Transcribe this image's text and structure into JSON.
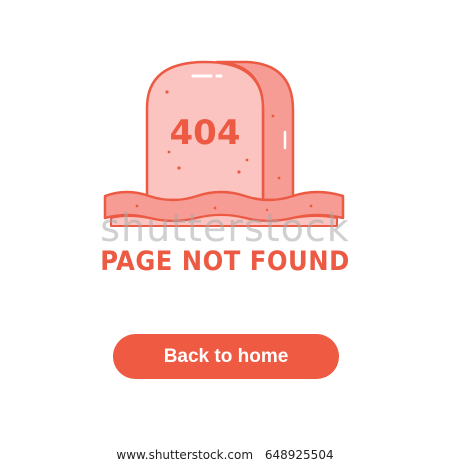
{
  "illustration": {
    "tombstone_text": "404",
    "icon": "tombstone-icon"
  },
  "headline": "PAGE NOT FOUND",
  "button": {
    "label": "Back to home"
  },
  "watermark": "shutterstock",
  "footer": {
    "site": "www.shutterstock.com",
    "image_id": "648925504"
  },
  "colors": {
    "accent": "#ef5a42",
    "stone_face": "#fbc4c0",
    "stone_side": "#f69c94",
    "outline": "#ec5a44",
    "background": "#ffffff"
  }
}
